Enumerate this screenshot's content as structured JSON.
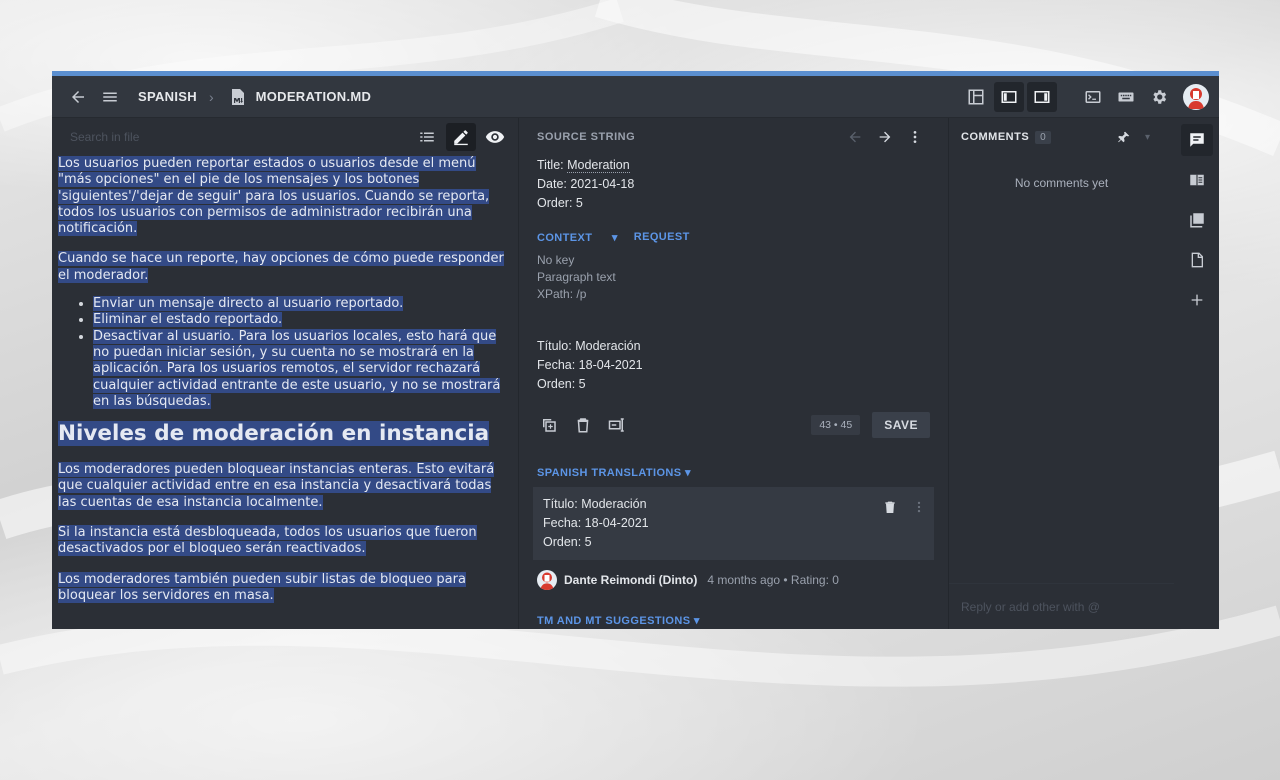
{
  "breadcrumb": {
    "language": "SPANISH",
    "file": "MODERATION.MD"
  },
  "search": {
    "placeholder": "Search in file"
  },
  "document": {
    "p1": "Los usuarios pueden reportar estados o usuarios desde el menú \"más opciones\" en el pie de los mensajes y los botones 'siguientes'/'dejar de seguir' para los usuarios. Cuando se reporta, todos los usuarios con permisos de administrador recibirán una notificación.",
    "p2": "Cuando se hace un reporte, hay opciones de cómo puede responder el moderador.",
    "list": [
      "Enviar un mensaje directo al usuario reportado.",
      "Eliminar el estado reportado.",
      "Desactivar al usuario. Para los usuarios locales, esto hará que no puedan iniciar sesión, y su cuenta no se mostrará en la aplicación. Para los usuarios remotos, el servidor rechazará cualquier actividad entrante de este usuario, y no se mostrará en las búsquedas."
    ],
    "heading": "Niveles de moderación en instancia",
    "p3": "Los moderadores pueden bloquear instancias enteras. Esto evitará que cualquier actividad entre en esa instancia y desactivará todas las cuentas de esa instancia localmente.",
    "p4": "Si la instancia está desbloqueada, todos los usuarios que fueron desactivados por el bloqueo serán reactivados.",
    "p5": "Los moderadores también pueden subir listas de bloqueo para bloquear los servidores en masa."
  },
  "source": {
    "label": "SOURCE STRING",
    "title_prefix": "Title: ",
    "title_value": "Moderation",
    "date": "Date: 2021-04-18",
    "order": "Order: 5"
  },
  "context": {
    "label": "CONTEXT",
    "request_label": "REQUEST",
    "key": "No key",
    "type": "Paragraph text",
    "xpath": "XPath: /p"
  },
  "translation_editor": {
    "line1": "Título: Moderación",
    "line2": "Fecha: 18-04-2021",
    "line3": "Orden: 5",
    "counter": "43 • 45",
    "save_label": "SAVE"
  },
  "translations": {
    "label": "SPANISH TRANSLATIONS",
    "card": {
      "line1": "Título: Moderación",
      "line2": "Fecha: 18-04-2021",
      "line3": "Orden: 5"
    },
    "author": "Dante Reimondi (Dinto)",
    "meta": "4 months ago • Rating: 0"
  },
  "suggestions": {
    "label": "TM AND MT SUGGESTIONS"
  },
  "comments": {
    "label": "COMMENTS",
    "count": "0",
    "empty": "No comments yet",
    "reply_placeholder": "Reply or add other with @"
  },
  "colors": {
    "accent": "#5c95e6",
    "highlight": "#334a86",
    "background": "#2b2f36",
    "topbar": "#32373f"
  }
}
